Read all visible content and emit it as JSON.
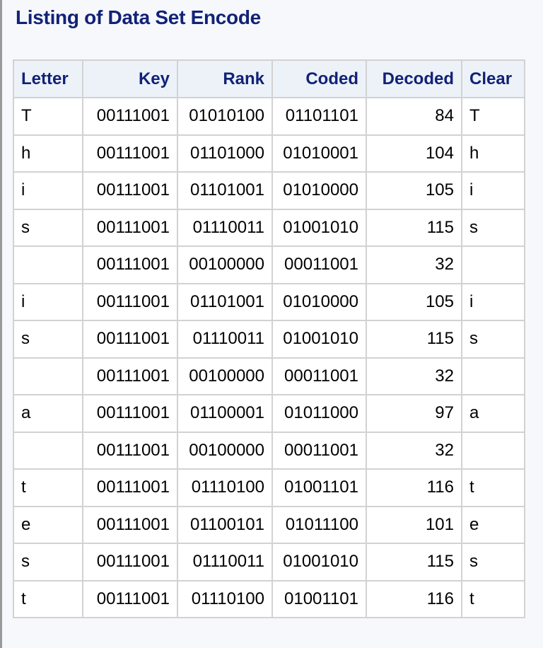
{
  "title": "Listing of Data Set Encode",
  "columns": [
    "Letter",
    "Key",
    "Rank",
    "Coded",
    "Decoded",
    "Clear"
  ],
  "rows": [
    [
      "T",
      "00111001",
      "01010100",
      "01101101",
      "84",
      "T"
    ],
    [
      "h",
      "00111001",
      "01101000",
      "01010001",
      "104",
      "h"
    ],
    [
      "i",
      "00111001",
      "01101001",
      "01010000",
      "105",
      "i"
    ],
    [
      "s",
      "00111001",
      "01110011",
      "01001010",
      "115",
      "s"
    ],
    [
      "",
      "00111001",
      "00100000",
      "00011001",
      "32",
      ""
    ],
    [
      "i",
      "00111001",
      "01101001",
      "01010000",
      "105",
      "i"
    ],
    [
      "s",
      "00111001",
      "01110011",
      "01001010",
      "115",
      "s"
    ],
    [
      "",
      "00111001",
      "00100000",
      "00011001",
      "32",
      ""
    ],
    [
      "a",
      "00111001",
      "01100001",
      "01011000",
      "97",
      "a"
    ],
    [
      "",
      "00111001",
      "00100000",
      "00011001",
      "32",
      ""
    ],
    [
      "t",
      "00111001",
      "01110100",
      "01001101",
      "116",
      "t"
    ],
    [
      "e",
      "00111001",
      "01100101",
      "01011100",
      "101",
      "e"
    ],
    [
      "s",
      "00111001",
      "01110011",
      "01001010",
      "115",
      "s"
    ],
    [
      "t",
      "00111001",
      "01110100",
      "01001101",
      "116",
      "t"
    ]
  ]
}
